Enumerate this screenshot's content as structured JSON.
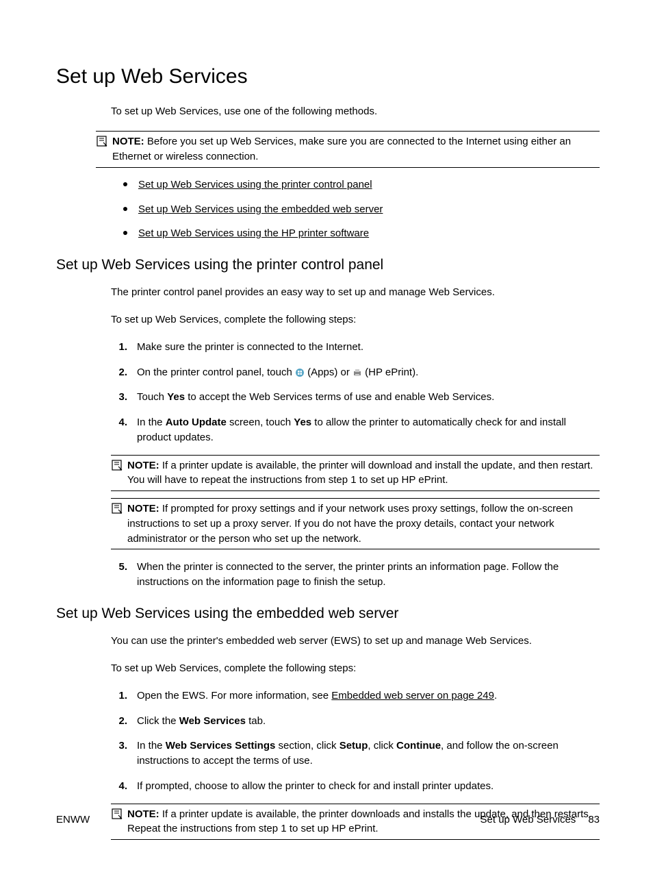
{
  "title": "Set up Web Services",
  "intro": "To set up Web Services, use one of the following methods.",
  "note_label": "NOTE:",
  "note_intro": "Before you set up Web Services, make sure you are connected to the Internet using either an Ethernet or wireless connection.",
  "toc": {
    "i1": "Set up Web Services using the printer control panel",
    "i2": "Set up Web Services using the embedded web server",
    "i3": "Set up Web Services using the HP printer software"
  },
  "s1": {
    "heading": "Set up Web Services using the printer control panel",
    "p1": "The printer control panel provides an easy way to set up and manage Web Services.",
    "p2": "To set up Web Services, complete the following steps:",
    "step1": "Make sure the printer is connected to the Internet.",
    "step2_a": "On the printer control panel, touch ",
    "icon_apps": "apps-icon",
    "step2_b": " (Apps) or ",
    "icon_eprint": "hp-eprint-icon",
    "step2_c": " (HP ePrint).",
    "step3_a": "Touch ",
    "step3_bold": "Yes",
    "step3_b": " to accept the Web Services terms of use and enable Web Services.",
    "step4_a": "In the ",
    "step4_bold1": "Auto Update",
    "step4_b": " screen, touch ",
    "step4_bold2": "Yes",
    "step4_c": " to allow the printer to automatically check for and install product updates.",
    "note1": "If a printer update is available, the printer will download and install the update, and then restart. You will have to repeat the instructions from step 1 to set up HP ePrint.",
    "note2": "If prompted for proxy settings and if your network uses proxy settings, follow the on-screen instructions to set up a proxy server. If you do not have the proxy details, contact your network administrator or the person who set up the network.",
    "step5": "When the printer is connected to the server, the printer prints an information page. Follow the instructions on the information page to finish the setup."
  },
  "s2": {
    "heading": "Set up Web Services using the embedded web server",
    "p1": "You can use the printer's embedded web server (EWS) to set up and manage Web Services.",
    "p2": "To set up Web Services, complete the following steps:",
    "step1_a": "Open the EWS. For more information, see ",
    "step1_link": "Embedded web server on page 249",
    "step1_b": ".",
    "step2_a": "Click the ",
    "step2_bold": "Web Services",
    "step2_b": " tab.",
    "step3_a": "In the ",
    "step3_bold1": "Web Services Settings",
    "step3_b": " section, click ",
    "step3_bold2": "Setup",
    "step3_c": ", click ",
    "step3_bold3": "Continue",
    "step3_d": ", and follow the on-screen instructions to accept the terms of use.",
    "step4": "If prompted, choose to allow the printer to check for and install printer updates.",
    "note1": "If a printer update is available, the printer downloads and installs the update, and then restarts. Repeat the instructions from step 1 to set up HP ePrint."
  },
  "footer": {
    "left": "ENWW",
    "right_text": "Set up Web Services",
    "page": "83"
  }
}
